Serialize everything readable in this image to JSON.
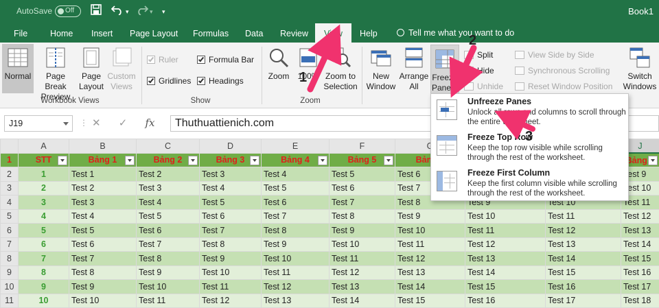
{
  "titlebar": {
    "autosave_label": "AutoSave",
    "autosave_state": "Off",
    "book_name": "Book1"
  },
  "tabs": {
    "items": [
      "File",
      "Home",
      "Insert",
      "Page Layout",
      "Formulas",
      "Data",
      "Review",
      "View",
      "Help"
    ],
    "active": "View",
    "tell_me": "Tell me what you want to do"
  },
  "ribbon": {
    "workbook_views": {
      "normal": "Normal",
      "page_break_1": "Page Break",
      "page_break_2": "Preview",
      "page_layout_1": "Page",
      "page_layout_2": "Layout",
      "custom_1": "Custom",
      "custom_2": "Views",
      "group_label": "Workbook Views"
    },
    "show": {
      "ruler": "Ruler",
      "formula_bar": "Formula Bar",
      "gridlines": "Gridlines",
      "headings": "Headings",
      "group_label": "Show"
    },
    "zoom": {
      "zoom": "Zoom",
      "hundred": "100%",
      "zoom_sel_1": "Zoom to",
      "zoom_sel_2": "Selection",
      "group_label": "Zoom"
    },
    "window": {
      "new_1": "New",
      "new_2": "Window",
      "arrange_1": "Arrange",
      "arrange_2": "All",
      "freeze_1": "Freeze",
      "freeze_2": "Panes",
      "split": "Split",
      "hide": "Hide",
      "unhide": "Unhide",
      "side_by_side": "View Side by Side",
      "sync_scroll": "Synchronous Scrolling",
      "reset_pos": "Reset Window Position",
      "switch_1": "Switch",
      "switch_2": "Windows"
    }
  },
  "formula_bar": {
    "name_box": "J19",
    "fx": "fx",
    "value": "Thuthuattienich.com"
  },
  "grid": {
    "columns": [
      "A",
      "B",
      "C",
      "D",
      "E",
      "F",
      "G",
      "H",
      "I",
      "J"
    ],
    "header": [
      "STT",
      "Bảng 1",
      "Bảng  2",
      "Bảng 3",
      "Bảng 4",
      "Bảng 5",
      "Bảng 6",
      "",
      "",
      "Bảng 9"
    ],
    "rows": [
      [
        "1",
        "Test 1",
        "Test 2",
        "Test 3",
        "Test 4",
        "Test 5",
        "Test 6",
        "",
        "",
        "Test 9"
      ],
      [
        "2",
        "Test 2",
        "Test 3",
        "Test 4",
        "Test 5",
        "Test 6",
        "Test 7",
        "",
        "",
        "Test 10"
      ],
      [
        "3",
        "Test 3",
        "Test 4",
        "Test 5",
        "Test 6",
        "Test 7",
        "Test 8",
        "Test 9",
        "Test 10",
        "Test 11"
      ],
      [
        "4",
        "Test 4",
        "Test 5",
        "Test 6",
        "Test 7",
        "Test 8",
        "Test 9",
        "Test 10",
        "Test 11",
        "Test 12"
      ],
      [
        "5",
        "Test 5",
        "Test 6",
        "Test 7",
        "Test 8",
        "Test 9",
        "Test 10",
        "Test 11",
        "Test 12",
        "Test 13"
      ],
      [
        "6",
        "Test 6",
        "Test 7",
        "Test 8",
        "Test 9",
        "Test 10",
        "Test 11",
        "Test 12",
        "Test 13",
        "Test 14"
      ],
      [
        "7",
        "Test 7",
        "Test 8",
        "Test 9",
        "Test 10",
        "Test 11",
        "Test 12",
        "Test 13",
        "Test 14",
        "Test 15"
      ],
      [
        "8",
        "Test 8",
        "Test 9",
        "Test 10",
        "Test 11",
        "Test 12",
        "Test 13",
        "Test 14",
        "Test 15",
        "Test 16"
      ],
      [
        "9",
        "Test 9",
        "Test 10",
        "Test 11",
        "Test 12",
        "Test 13",
        "Test 14",
        "Test 15",
        "Test 16",
        "Test 17"
      ],
      [
        "10",
        "Test 10",
        "Test 11",
        "Test 12",
        "Test 13",
        "Test 14",
        "Test 15",
        "Test 16",
        "Test 17",
        "Test 18"
      ]
    ],
    "row_numbers": [
      "1",
      "2",
      "3",
      "4",
      "5",
      "6",
      "7",
      "8",
      "9",
      "10",
      "11"
    ]
  },
  "freeze_menu": [
    {
      "title": "Unfreeze Panes",
      "desc": "Unlock all rows and columns to scroll through the entire worksheet."
    },
    {
      "title": "Freeze Top Row",
      "desc": "Keep the top row visible while scrolling through the rest of the worksheet."
    },
    {
      "title": "Freeze First Column",
      "desc": "Keep the first column visible while scrolling through the rest of the worksheet."
    }
  ],
  "annotations": [
    "1",
    "2",
    "3"
  ],
  "colors": {
    "excel_green": "#217346",
    "header_green": "#70ad47",
    "row_dark": "#c5e0b3",
    "row_light": "#e2efd9",
    "header_text": "#e0201a",
    "arrow": "#f0326e"
  }
}
